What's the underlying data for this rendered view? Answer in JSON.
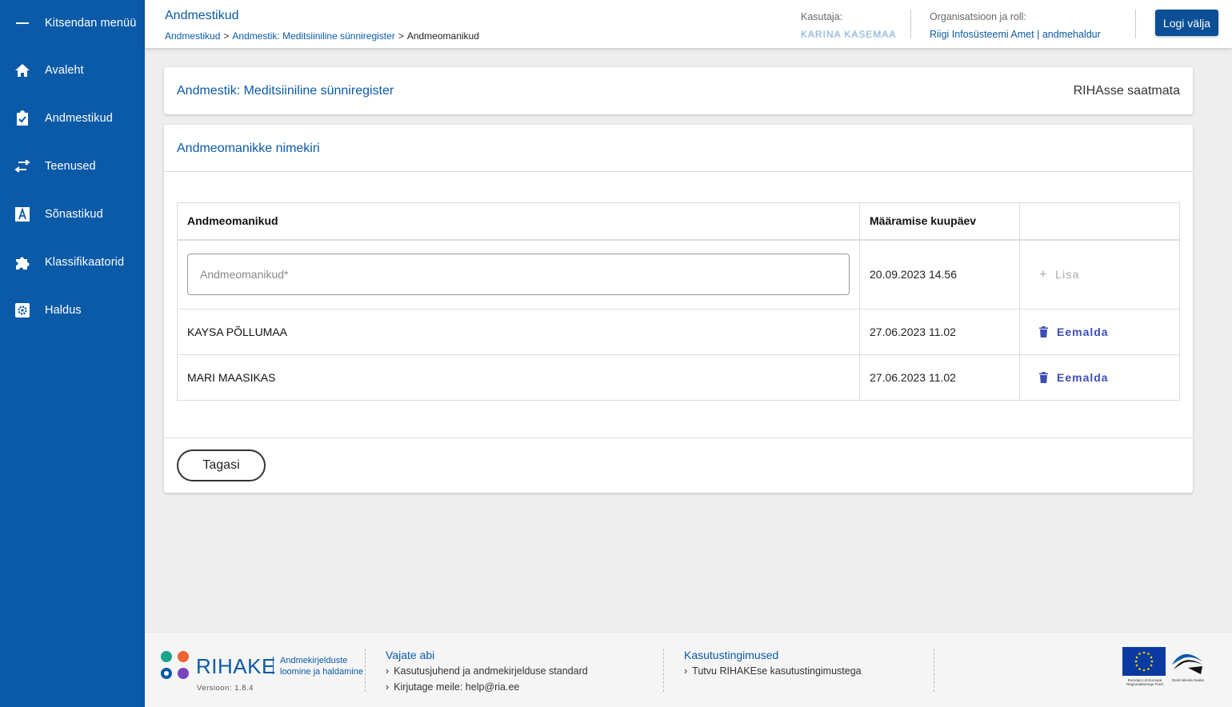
{
  "sidebar": {
    "collapse_label": "Kitsendan menüü",
    "items": [
      {
        "label": "Avaleht",
        "icon": "home-icon"
      },
      {
        "label": "Andmestikud",
        "icon": "clipboard-check-icon"
      },
      {
        "label": "Teenused",
        "icon": "swap-arrows-icon"
      },
      {
        "label": "Sõnastikud",
        "icon": "letter-a-icon"
      },
      {
        "label": "Klassifikaatorid",
        "icon": "puzzle-icon"
      },
      {
        "label": "Haldus",
        "icon": "settings-box-icon"
      }
    ]
  },
  "header": {
    "title": "Andmestikud",
    "breadcrumbs": [
      "Andmestikud",
      "Andmestik: Meditsiiniline sünniregister",
      "Andmeomanikud"
    ],
    "user_label": "Kasutaja:",
    "user_value": "KARINA KASEMAA",
    "org_label": "Organisatsioon ja roll:",
    "org_name": "Riigi Infosüsteemi Amet",
    "org_sep": "|",
    "org_role": "andmehaldur",
    "logout_label": "Logi välja"
  },
  "dataset_card": {
    "title": "Andmestik: Meditsiiniline sünniregister",
    "status": "RIHAsse saatmata"
  },
  "owners_card": {
    "title": "Andmeomanikke nimekiri",
    "columns": [
      "Andmeomanikud",
      "Määramise kuupäev",
      ""
    ],
    "input": {
      "placeholder": "Andmeomanikud*",
      "value": ""
    },
    "input_date": "20.09.2023 14.56",
    "add_label": "Lisa",
    "rows": [
      {
        "name": "KAYSA PÕLLUMAA",
        "date": "27.06.2023 11.02",
        "action": "Eemalda"
      },
      {
        "name": "MARI MAASIKAS",
        "date": "27.06.2023 11.02",
        "action": "Eemalda"
      }
    ],
    "back_label": "Tagasi"
  },
  "footer": {
    "logo_name": "RIHAKE",
    "logo_tagline": "Andmekirjelduste loomine ja haldamine",
    "version": "Versioon: 1.8.4",
    "help_title": "Vajate abi",
    "help_links": [
      "Kasutusjuhend ja andmekirjelduse standard",
      "Kirjutage meile: help@ria.ee"
    ],
    "terms_title": "Kasutustingimused",
    "terms_links": [
      "Tutvu RIHAKEse kasutustingimustega"
    ],
    "eu_text": "Euroopa Liit Euroopa Regionaalarengu Fond",
    "est_text": "Eesti tuleviku heaks"
  },
  "colors": {
    "sidebar_bg": "#0b5aa8",
    "accent": "#0b5aa8",
    "remove_action": "#3d4db5",
    "logo_dots": [
      "#1aa38f",
      "#ef6234",
      "#0b5aa8",
      "#7a44c0"
    ]
  }
}
